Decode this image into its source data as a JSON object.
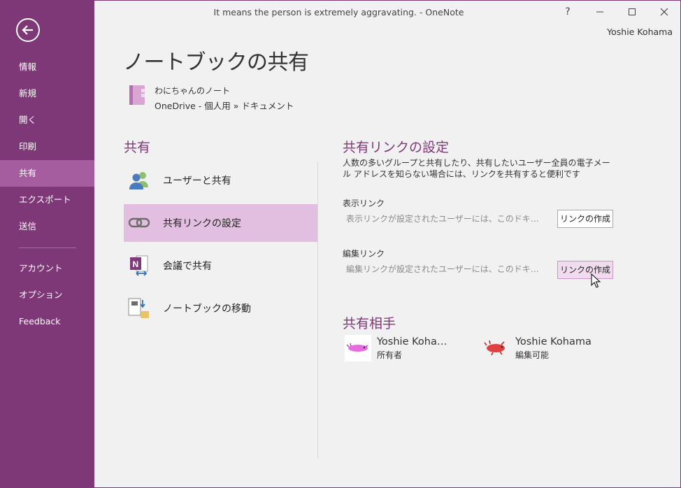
{
  "window": {
    "title": "It means the person is extremely aggravating. - OneNote",
    "help": "?",
    "minimize": "—",
    "maximize": "☐",
    "close": "✕",
    "user": "Yoshie Kohama"
  },
  "sidebar": {
    "items": [
      {
        "label": "情報"
      },
      {
        "label": "新規"
      },
      {
        "label": "開く"
      },
      {
        "label": "印刷"
      },
      {
        "label": "共有",
        "active": true
      },
      {
        "label": "エクスポート"
      },
      {
        "label": "送信"
      },
      {
        "label": "アカウント"
      },
      {
        "label": "オプション"
      },
      {
        "label": "Feedback"
      }
    ]
  },
  "page": {
    "title": "ノートブックの共有",
    "notebook_name": "わにちゃんのノート",
    "notebook_path": "OneDrive - 個人用 » ドキュメント"
  },
  "share": {
    "heading": "共有",
    "options": [
      {
        "label": "ユーザーと共有",
        "icon": "people-icon"
      },
      {
        "label": "共有リンクの設定",
        "icon": "link-icon",
        "active": true
      },
      {
        "label": "会議で共有",
        "icon": "onenote-meeting-icon"
      },
      {
        "label": "ノートブックの移動",
        "icon": "move-notebook-icon"
      }
    ]
  },
  "link_settings": {
    "heading": "共有リンクの設定",
    "description": "人数の多いグループと共有したり、共有したいユーザー全員の電子メール アドレスを知らない場合には、リンクを共有すると便利です",
    "view_label": "表示リンク",
    "view_value": "表示リンクが設定されたユーザーには、このドキュメントへのアクセス権が付与されます",
    "view_button": "リンクの作成",
    "edit_label": "編集リンク",
    "edit_value": "編集リンクが設定されたユーザーには、このドキュメントへのアクセス権が付与されます",
    "edit_button": "リンクの作成"
  },
  "shared_with": {
    "heading": "共有相手",
    "people": [
      {
        "name": "Yoshie Koha…",
        "role": "所有者"
      },
      {
        "name": "Yoshie Kohama",
        "role": "編集可能"
      }
    ]
  },
  "colors": {
    "accent": "#7e3878",
    "sidebar_active": "#a65d9f",
    "option_active": "#e2bfe0"
  }
}
